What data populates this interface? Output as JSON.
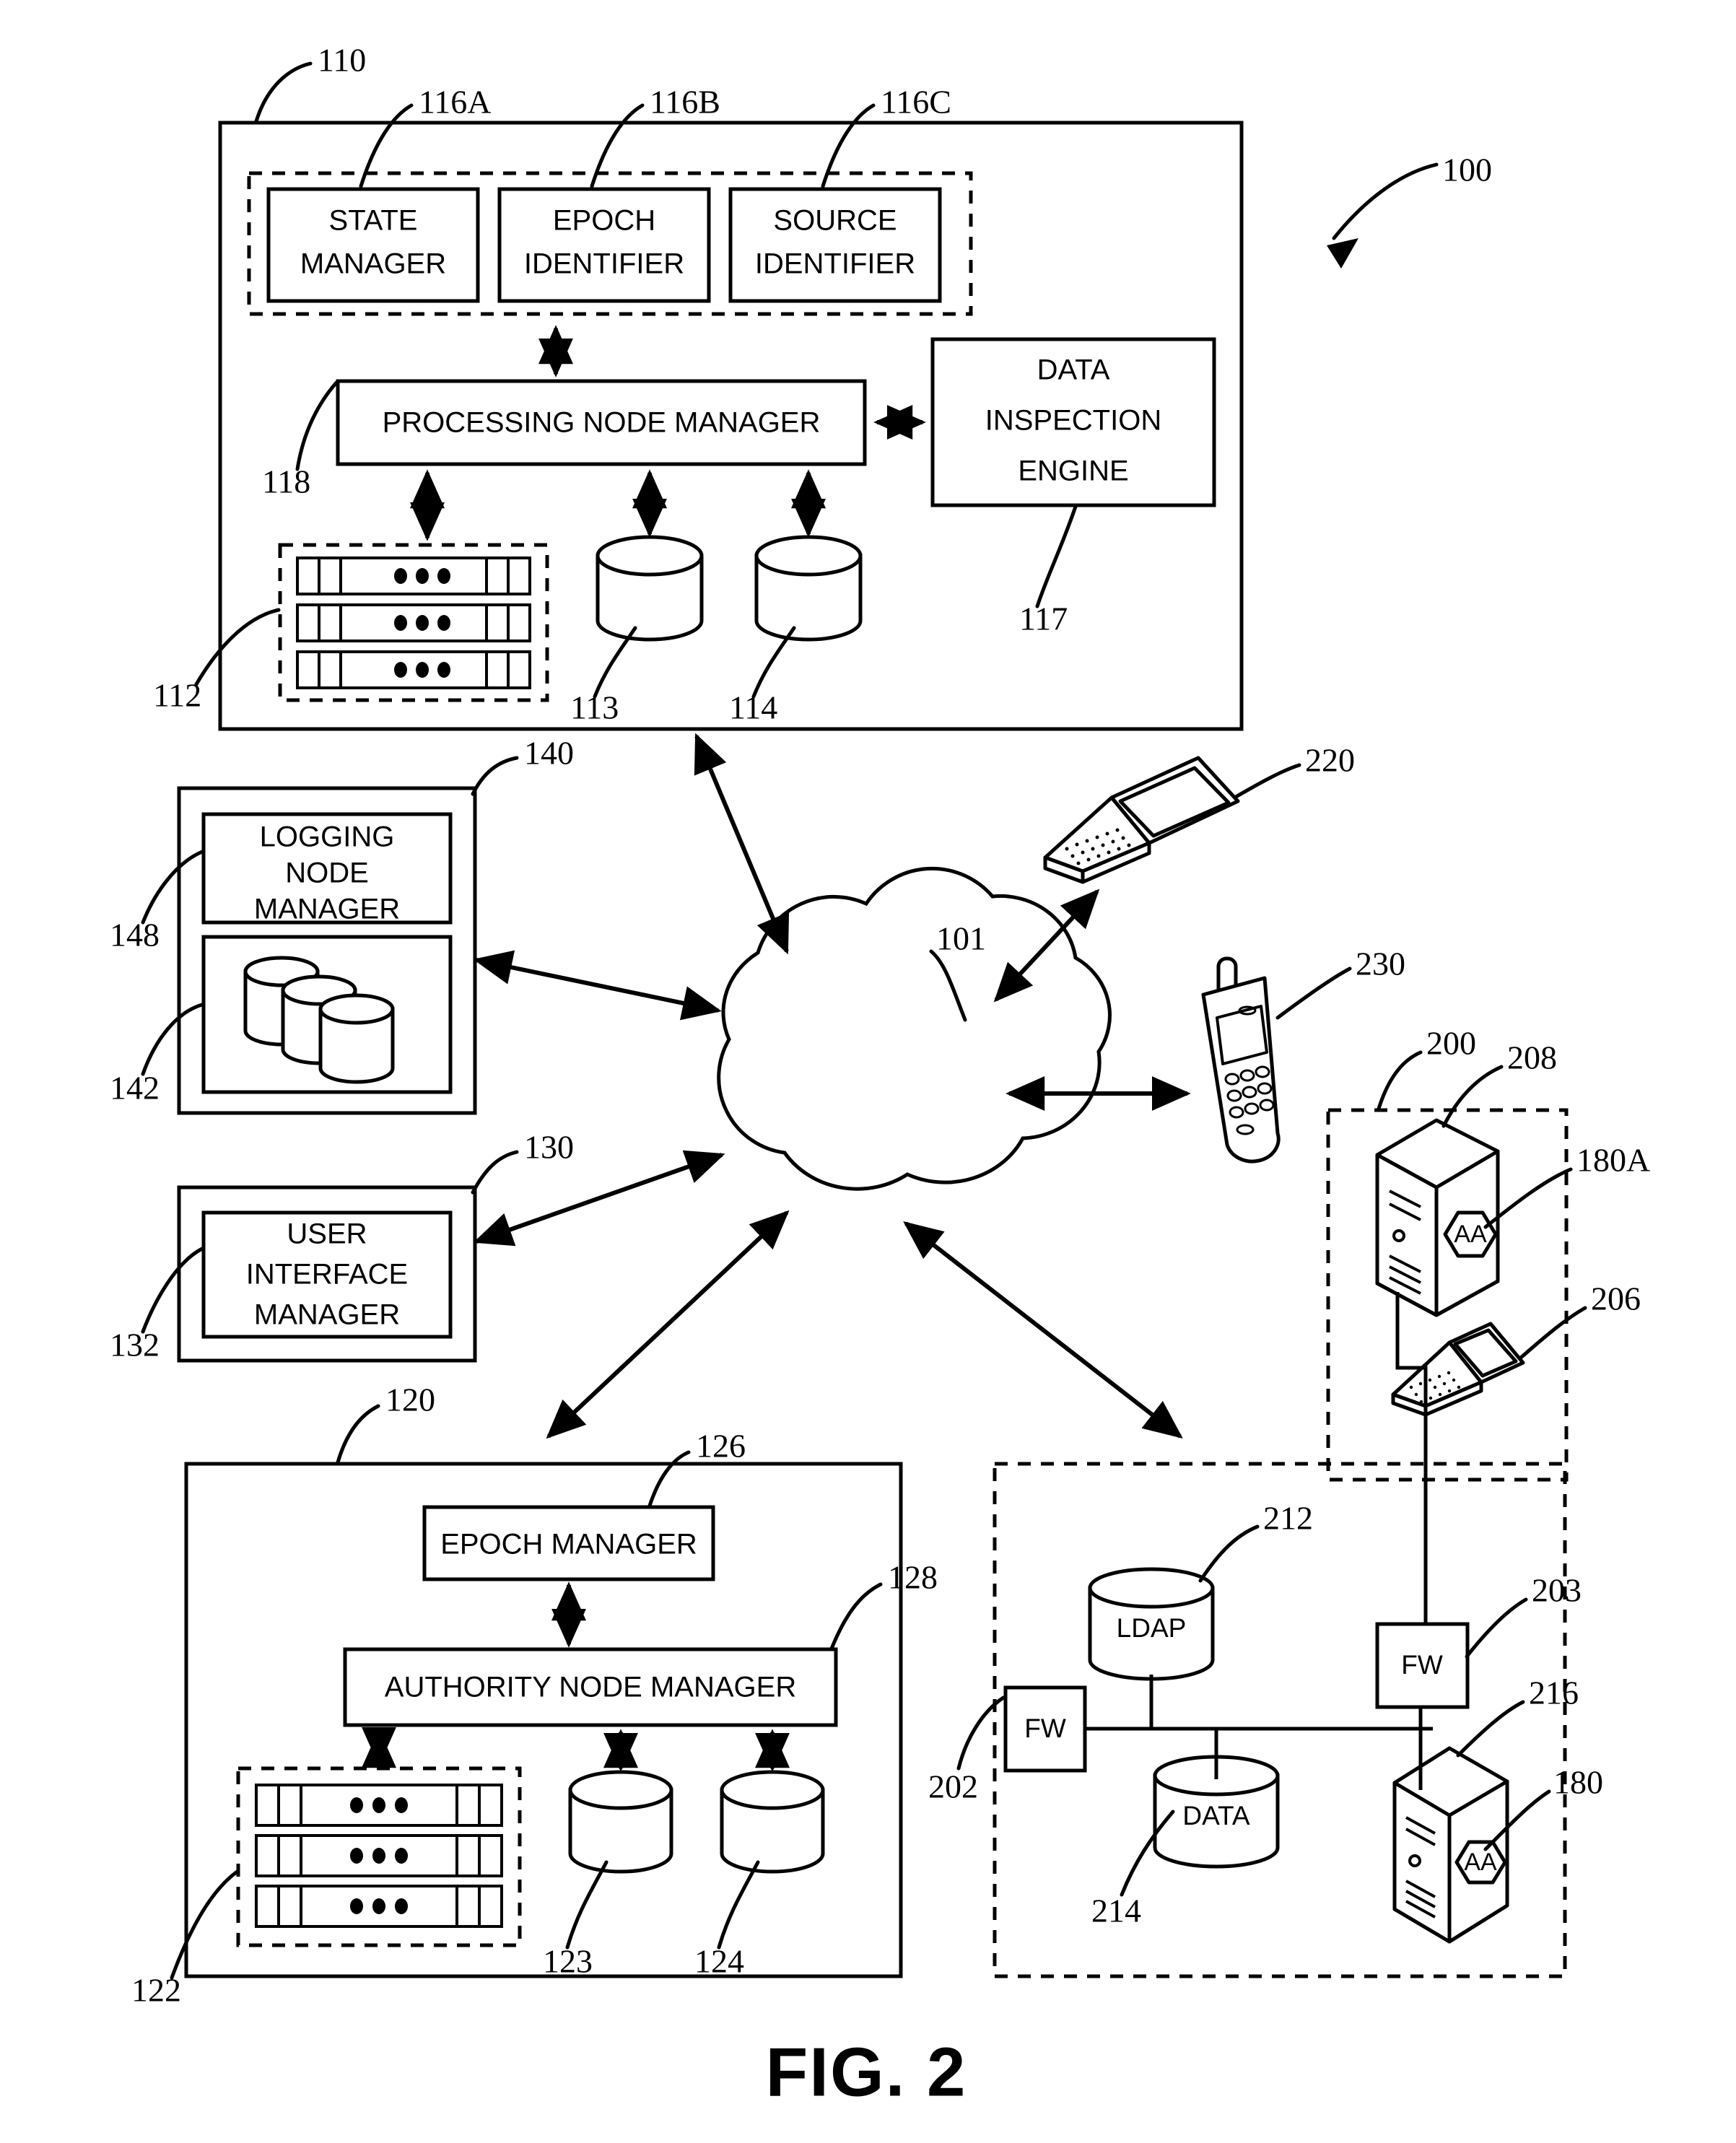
{
  "figure": {
    "caption": "FIG. 2",
    "system_ref": "100",
    "network_ref": "101"
  },
  "processing_node": {
    "ref": "110",
    "manager_label": "PROCESSING NODE MANAGER",
    "manager_ref": "118",
    "modules": [
      {
        "label_line1": "STATE",
        "label_line2": "MANAGER",
        "ref": "116A"
      },
      {
        "label_line1": "EPOCH",
        "label_line2": "IDENTIFIER",
        "ref": "116B"
      },
      {
        "label_line1": "SOURCE",
        "label_line2": "IDENTIFIER",
        "ref": "116C"
      }
    ],
    "inspection_engine": {
      "line1": "DATA",
      "line2": "INSPECTION",
      "line3": "ENGINE",
      "ref": "117"
    },
    "rack_ref": "112",
    "db_left_ref": "113",
    "db_right_ref": "114"
  },
  "logging_node": {
    "ref": "140",
    "manager_line1": "LOGGING",
    "manager_line2": "NODE",
    "manager_line3": "MANAGER",
    "manager_ref": "148",
    "storage_ref": "142"
  },
  "user_interface_node": {
    "ref": "130",
    "manager_line1": "USER",
    "manager_line2": "INTERFACE",
    "manager_line3": "MANAGER",
    "manager_ref": "132"
  },
  "authority_node": {
    "ref": "120",
    "epoch_manager_label": "EPOCH MANAGER",
    "epoch_manager_ref": "126",
    "authority_manager_label": "AUTHORITY NODE MANAGER",
    "authority_manager_ref": "128",
    "rack_ref": "122",
    "db_left_ref": "123",
    "db_right_ref": "124"
  },
  "clients": {
    "laptop_ref": "220",
    "phone_ref": "230"
  },
  "enterprise_upper": {
    "ref": "200",
    "server_ref": "208",
    "server_badge": "AA",
    "badge_ref": "180A",
    "laptop_ref": "206"
  },
  "enterprise_lower": {
    "ref": "202",
    "firewall_left_label": "FW",
    "firewall_right_label": "FW",
    "firewall_right_ref": "203",
    "ldap_label": "LDAP",
    "ldap_ref": "212",
    "data_label": "DATA",
    "data_ref": "214",
    "server_ref": "216",
    "server_badge": "AA",
    "badge_ref": "180"
  },
  "colors": {
    "ink": "#000000",
    "paper": "#ffffff"
  }
}
